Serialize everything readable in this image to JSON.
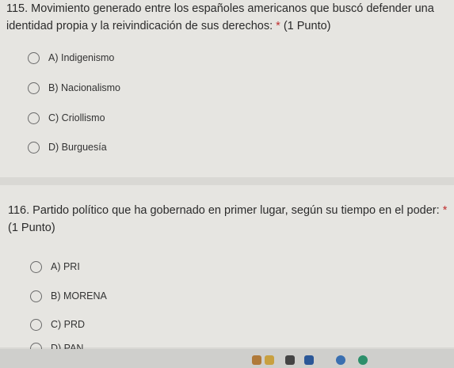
{
  "questions": [
    {
      "text": "115. Movimiento generado entre los españoles americanos que buscó defender una identidad propia y la reivindicación de sus derechos:",
      "required_mark": "*",
      "points": "(1 Punto)",
      "options": [
        "A) Indigenismo",
        "B) Nacionalismo",
        "C) Criollismo",
        "D) Burguesía"
      ]
    },
    {
      "text": "116. Partido político que ha gobernado en primer lugar, según su tiempo en el poder:",
      "required_mark": "*",
      "points": "(1 Punto)",
      "options": [
        "A) PRI",
        "B) MORENA",
        "C) PRD",
        "D) PAN"
      ]
    }
  ],
  "colors": {
    "background": "#d9d8d4",
    "card": "#e6e5e1",
    "required": "#c03030",
    "radio_border": "#6a6a6a"
  },
  "taskbar_icons": [
    "app-icon",
    "app-icon",
    "app-icon",
    "word-icon",
    "app-icon",
    "app-icon"
  ]
}
